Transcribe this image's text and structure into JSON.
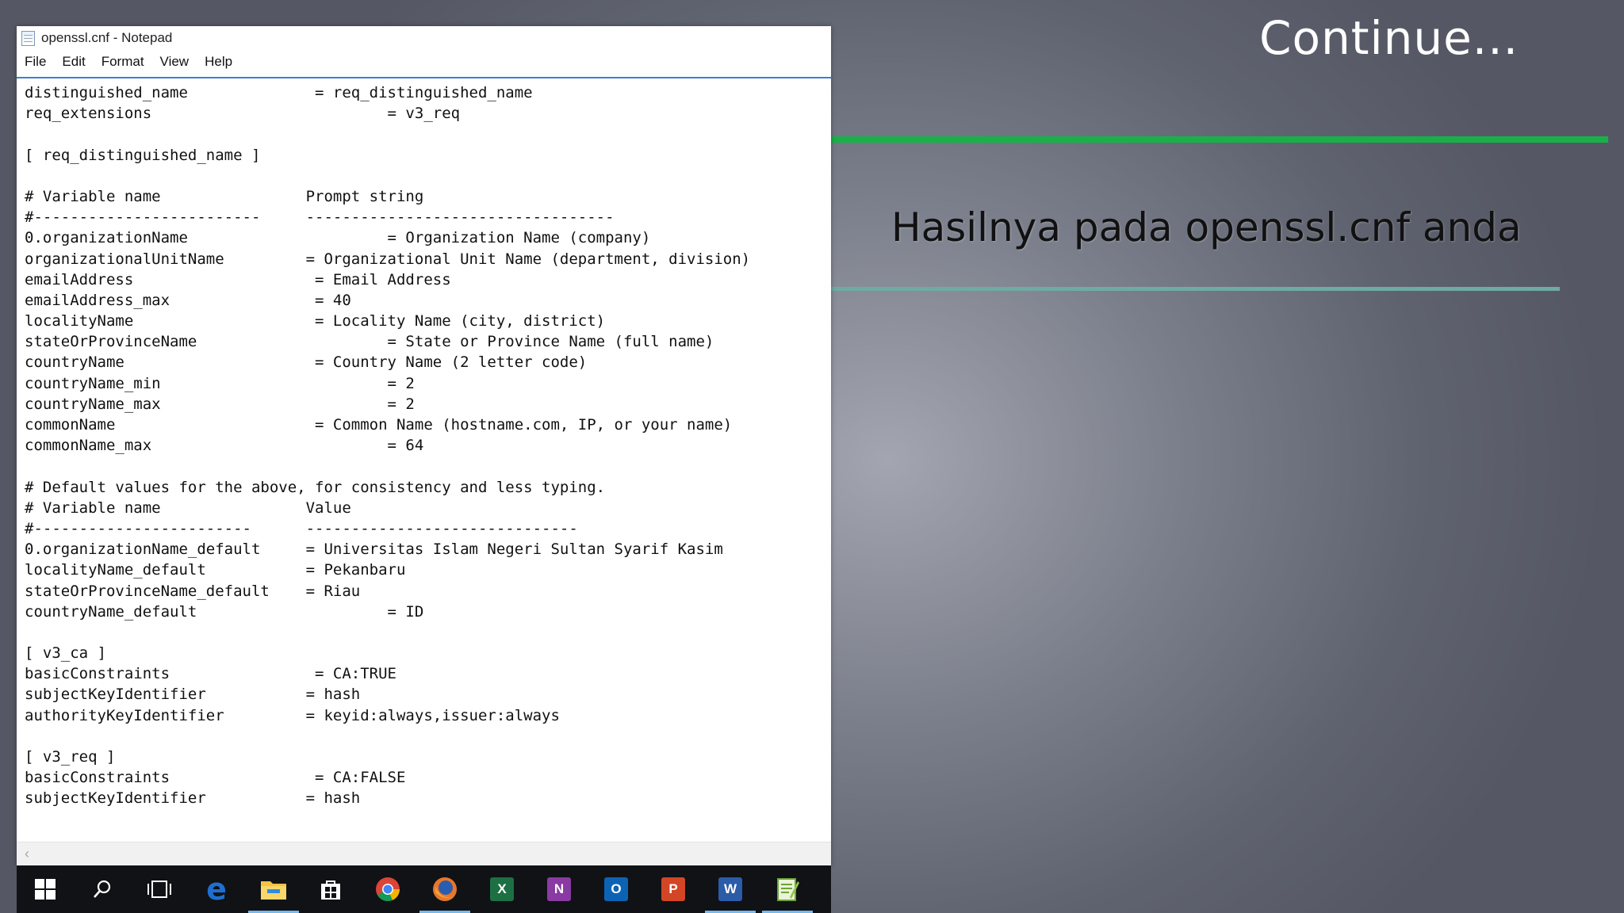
{
  "slide": {
    "title": "Continue...",
    "subtitle": "Hasilnya pada openssl.cnf anda",
    "colors": {
      "accent_bar": "#19b04a",
      "divider": "#6faaa3"
    }
  },
  "window": {
    "title": "openssl.cnf - Notepad",
    "menu": [
      "File",
      "Edit",
      "Format",
      "View",
      "Help"
    ]
  },
  "editor": {
    "lines": [
      "distinguished_name              = req_distinguished_name",
      "req_extensions                          = v3_req",
      "",
      "[ req_distinguished_name ]",
      "",
      "# Variable name                Prompt string",
      "#-------------------------     ----------------------------------",
      "0.organizationName                      = Organization Name (company)",
      "organizationalUnitName         = Organizational Unit Name (department, division)",
      "emailAddress                    = Email Address",
      "emailAddress_max                = 40",
      "localityName                    = Locality Name (city, district)",
      "stateOrProvinceName                     = State or Province Name (full name)",
      "countryName                     = Country Name (2 letter code)",
      "countryName_min                         = 2",
      "countryName_max                         = 2",
      "commonName                      = Common Name (hostname.com, IP, or your name)",
      "commonName_max                          = 64",
      "",
      "# Default values for the above, for consistency and less typing.",
      "# Variable name                Value",
      "#------------------------      ------------------------------",
      "0.organizationName_default     = Universitas Islam Negeri Sultan Syarif Kasim",
      "localityName_default           = Pekanbaru",
      "stateOrProvinceName_default    = Riau",
      "countryName_default                     = ID",
      "",
      "[ v3_ca ]",
      "basicConstraints                = CA:TRUE",
      "subjectKeyIdentifier           = hash",
      "authorityKeyIdentifier         = keyid:always,issuer:always",
      "",
      "[ v3_req ]",
      "basicConstraints                = CA:FALSE",
      "subjectKeyIdentifier           = hash"
    ]
  },
  "taskbar": {
    "items": [
      {
        "name": "start-button",
        "icon": "windows-logo-icon"
      },
      {
        "name": "search-button",
        "icon": "search-icon"
      },
      {
        "name": "task-view-button",
        "icon": "task-view-icon"
      },
      {
        "name": "edge-button",
        "icon": "edge-icon",
        "glyph": "e",
        "color": "#1e6fd0"
      },
      {
        "name": "file-explorer-button",
        "icon": "folder-icon",
        "color": "#f5c242",
        "active": true
      },
      {
        "name": "store-button",
        "icon": "store-icon",
        "color": "#ffffff"
      },
      {
        "name": "chrome-button",
        "icon": "chrome-icon"
      },
      {
        "name": "firefox-button",
        "icon": "firefox-icon",
        "color": "#e8772a",
        "active": true
      },
      {
        "name": "excel-button",
        "icon": "excel-icon",
        "glyph": "X",
        "color": "#1d7044"
      },
      {
        "name": "onenote-button",
        "icon": "onenote-icon",
        "glyph": "N",
        "color": "#8a3aa3"
      },
      {
        "name": "outlook-button",
        "icon": "outlook-icon",
        "glyph": "O",
        "color": "#0d63b3"
      },
      {
        "name": "powerpoint-button",
        "icon": "powerpoint-icon",
        "glyph": "P",
        "color": "#d24625"
      },
      {
        "name": "word-button",
        "icon": "word-icon",
        "glyph": "W",
        "color": "#2b5ca8",
        "active": true
      },
      {
        "name": "notepad-button",
        "icon": "notepad-icon",
        "color": "#8fc84a",
        "active": true
      }
    ]
  }
}
